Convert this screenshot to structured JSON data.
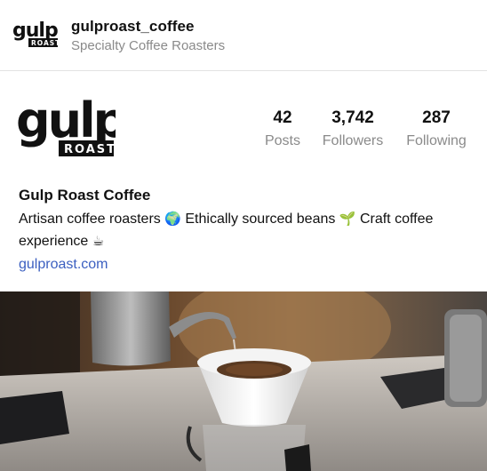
{
  "header": {
    "username": "gulproast_coffee",
    "subtitle": "Specialty Coffee Roasters",
    "avatar_logo": "gulp ROAST"
  },
  "profile": {
    "logo_text": "gulp",
    "logo_badge": "ROAST",
    "stats": {
      "posts": {
        "value": "42",
        "label": "Posts"
      },
      "followers": {
        "value": "3,742",
        "label": "Followers"
      },
      "following": {
        "value": "287",
        "label": "Following"
      }
    },
    "display_name": "Gulp Roast Coffee",
    "bio": {
      "part1": "Artisan coffee roasters",
      "emoji1": "🌍",
      "part2": "Ethically sourced beans",
      "emoji2": "🌱",
      "part3": "Craft coffee experience",
      "emoji3": "☕"
    },
    "link": "gulproast.com"
  },
  "photo": {
    "subject": "pour-over coffee being brewed with gooseneck kettle"
  },
  "colors": {
    "link": "#3b5fc0",
    "muted": "#8a8a8a",
    "divider": "#e3e3e3"
  }
}
